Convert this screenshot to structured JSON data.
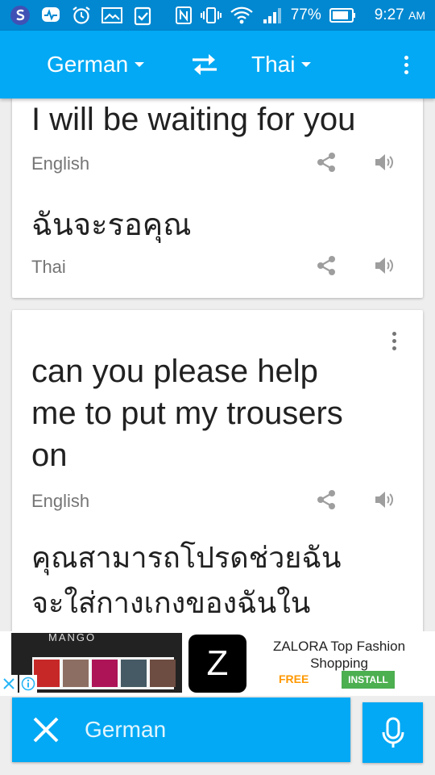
{
  "status_bar": {
    "battery": "77%",
    "time": "9:27",
    "ampm": "AM",
    "color": "#0288d1"
  },
  "toolbar": {
    "source_language": "German",
    "target_language": "Thai",
    "color": "#03a9f4",
    "icons": [
      "chevron-down-icon",
      "swap-icon",
      "overflow-menu-icon"
    ]
  },
  "cards": [
    {
      "source_text": "I will be waiting for you",
      "source_language": "English",
      "translation_text": "ฉันจะรอคุณ",
      "translation_language": "Thai"
    },
    {
      "source_lines": [
        "can you please help",
        "me to put my trousers",
        "on"
      ],
      "source_language": "English",
      "translation_lines": [
        "คุณสามารถโปรดช่วยฉัน",
        "จะใส่กางเกงของฉันใน"
      ]
    }
  ],
  "ad": {
    "image_brand": "MANGO",
    "logo_letter": "Z",
    "title": "ZALORA Top Fashion Shopping",
    "price": "FREE",
    "install_label": "INSTALL"
  },
  "input": {
    "placeholder_language": "German"
  }
}
